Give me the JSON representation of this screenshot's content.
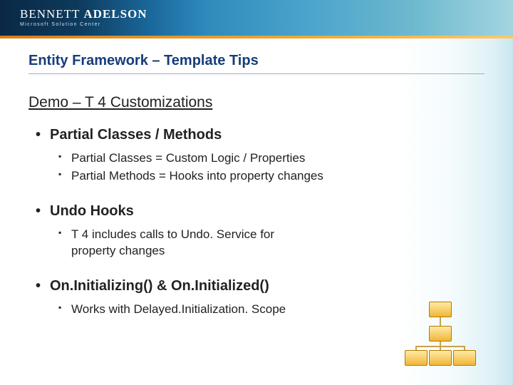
{
  "logo": {
    "brand_first": "BENNETT",
    "brand_second": "ADELSON",
    "tagline": "Microsoft Solution Center"
  },
  "slide": {
    "title": "Entity Framework – Template Tips",
    "section": "Demo – T 4 Customizations"
  },
  "bullets": [
    {
      "label": "Partial Classes / Methods",
      "sub": [
        "Partial Classes = Custom Logic / Properties",
        "Partial Methods = Hooks into property changes"
      ]
    },
    {
      "label": "Undo Hooks",
      "sub": [
        "T 4 includes calls to Undo. Service for property changes"
      ]
    },
    {
      "label": "On.Initializing() & On.Initialized()",
      "sub": [
        "Works with Delayed.Initialization. Scope"
      ]
    }
  ]
}
